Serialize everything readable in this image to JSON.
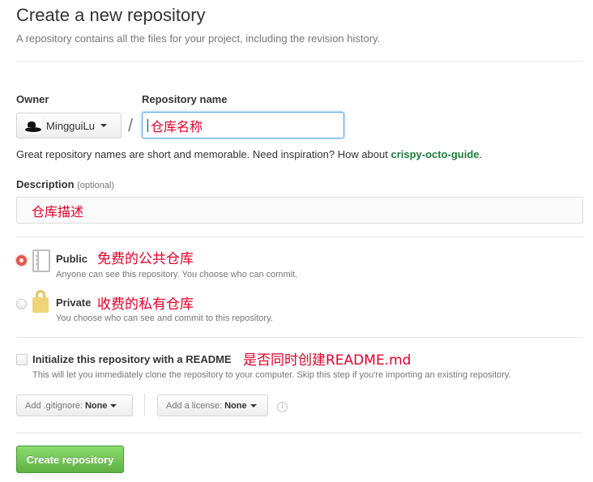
{
  "header": {
    "title": "Create a new repository",
    "subtitle": "A repository contains all the files for your project, including the revision history."
  },
  "owner": {
    "label": "Owner",
    "value": "MingguiLu",
    "separator": "/"
  },
  "repo_name": {
    "label": "Repository name",
    "value": "仓库名称"
  },
  "hint": {
    "text": "Great repository names are short and memorable. Need inspiration? How about ",
    "suggestion": "crispy-octo-guide",
    "end": "."
  },
  "description": {
    "label": "Description",
    "optional": "(optional)",
    "value": "仓库描述"
  },
  "visibility": {
    "public": {
      "title": "Public",
      "annotation": "免费的公共仓库",
      "desc": "Anyone can see this repository. You choose who can commit.",
      "selected": true
    },
    "private": {
      "title": "Private",
      "annotation": "收费的私有仓库",
      "desc": "You choose who can see and commit to this repository.",
      "selected": false
    }
  },
  "readme": {
    "title": "Initialize this repository with a README",
    "annotation": "是否同时创建README.md",
    "desc": "This will let you immediately clone the repository to your computer. Skip this step if you're importing an existing repository.",
    "checked": false
  },
  "gitignore": {
    "label": "Add .gitignore:",
    "value": "None"
  },
  "license": {
    "label": "Add a license:",
    "value": "None"
  },
  "info_icon_glyph": "i",
  "submit": {
    "label": "Create repository"
  },
  "colors": {
    "annotation": "#e0002a",
    "suggestion": "#1e7d3a",
    "primary_button": "#60b044",
    "focus_border": "#51a7e8"
  },
  "icons": {
    "public": "repo-book-icon",
    "private": "lock-icon",
    "info": "info-icon",
    "dropdown": "chevron-down-icon"
  }
}
